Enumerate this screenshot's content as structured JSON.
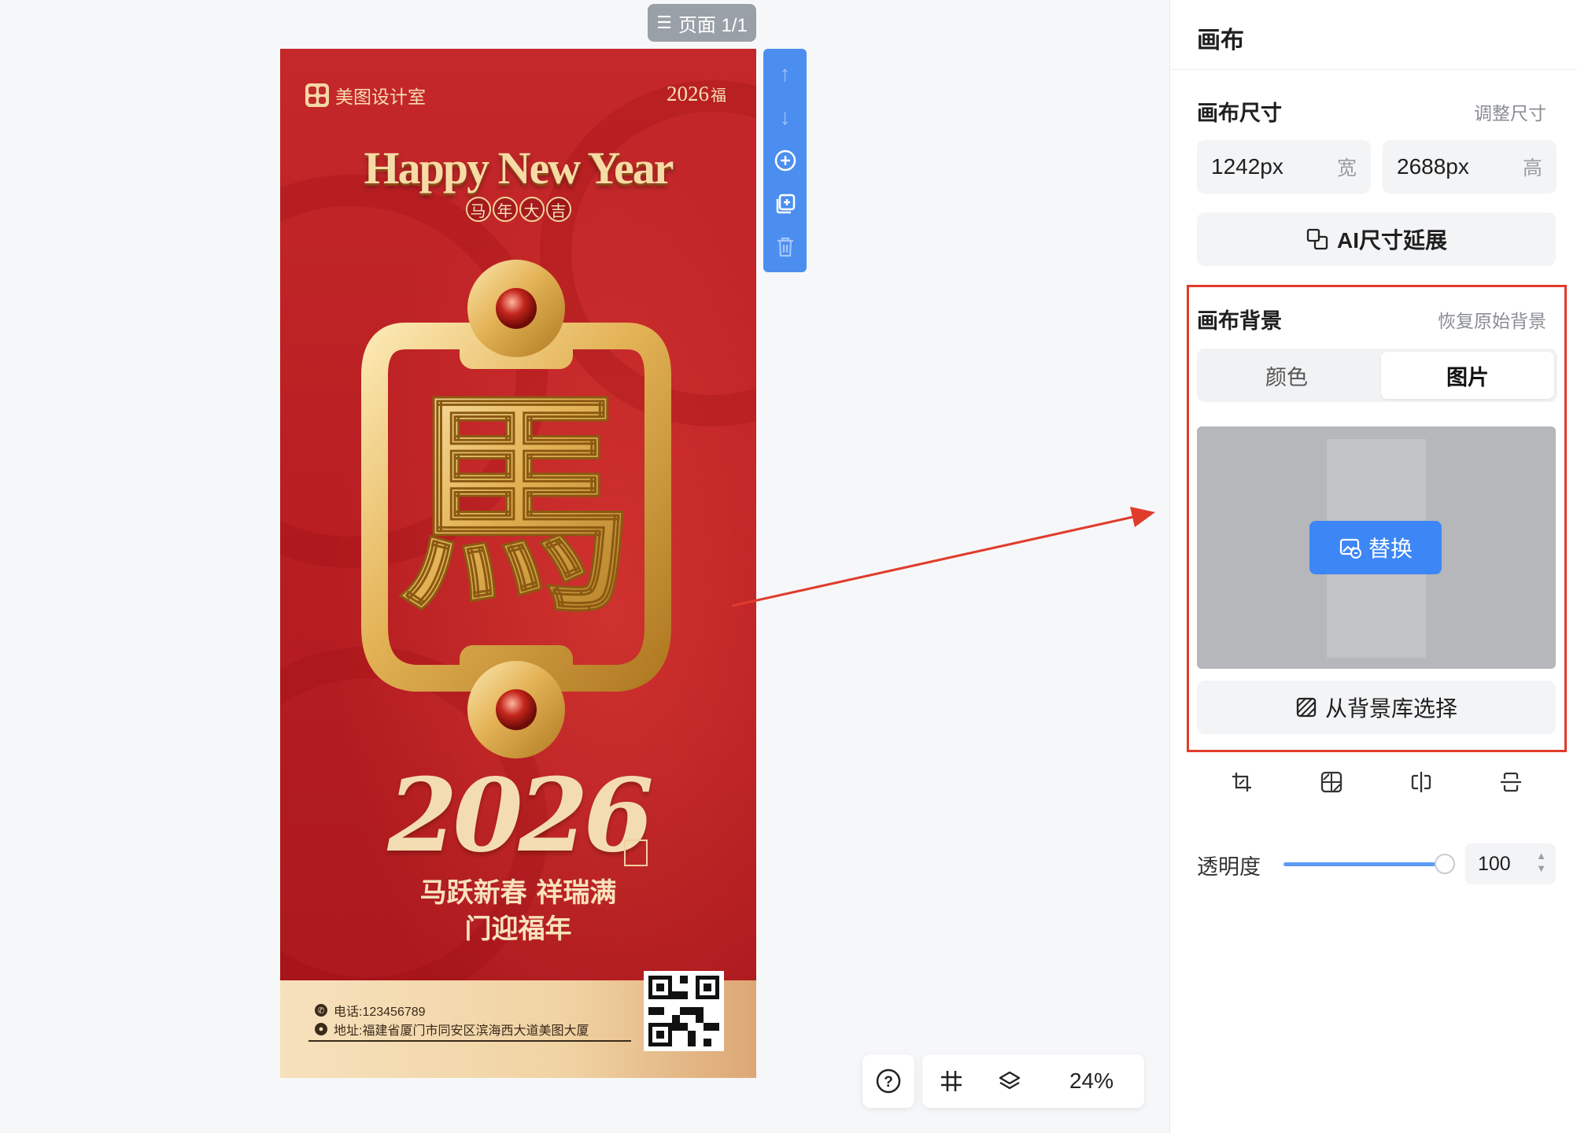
{
  "canvas": {
    "page_indicator": "页面 1/1",
    "zoom": "24%"
  },
  "poster": {
    "brand": "美图设计室",
    "year_top": "2026",
    "year_top_mark": "福",
    "greeting": "Happy New Year",
    "blessing": [
      "马",
      "年",
      "大",
      "吉"
    ],
    "emblem_char": "馬",
    "big_year": "2026",
    "slogan_line1": "马跃新春 祥瑞满",
    "slogan_line2": "门迎福年",
    "phone": "电话:123456789",
    "address": "地址:福建省厦门市同安区滨海西大道美图大厦"
  },
  "panel": {
    "title": "画布",
    "size": {
      "heading": "画布尺寸",
      "adjust_link": "调整尺寸",
      "width_value": "1242px",
      "width_unit": "宽",
      "height_value": "2688px",
      "height_unit": "高",
      "ai_extend": "AI尺寸延展"
    },
    "background": {
      "heading": "画布背景",
      "restore_link": "恢复原始背景",
      "tabs": [
        "颜色",
        "图片"
      ],
      "active_tab": "图片",
      "replace_button": "替换",
      "library_button": "从背景库选择"
    },
    "opacity": {
      "label": "透明度",
      "value": "100",
      "level": 1.0
    }
  },
  "colors": {
    "accent": "#3d86f5",
    "highlight": "#e03c2c",
    "poster_red": "#c5282a",
    "gold": "#f7dba6"
  },
  "icons": [
    "list-icon",
    "arrow-up-icon",
    "arrow-down-icon",
    "add-circle-icon",
    "duplicate-icon",
    "trash-icon",
    "help-icon",
    "grid-icon",
    "layers-icon",
    "resize-icon",
    "image-replace-icon",
    "pattern-icon",
    "crop-icon",
    "mosaic-icon",
    "flip-horizontal-icon",
    "flip-vertical-icon"
  ]
}
